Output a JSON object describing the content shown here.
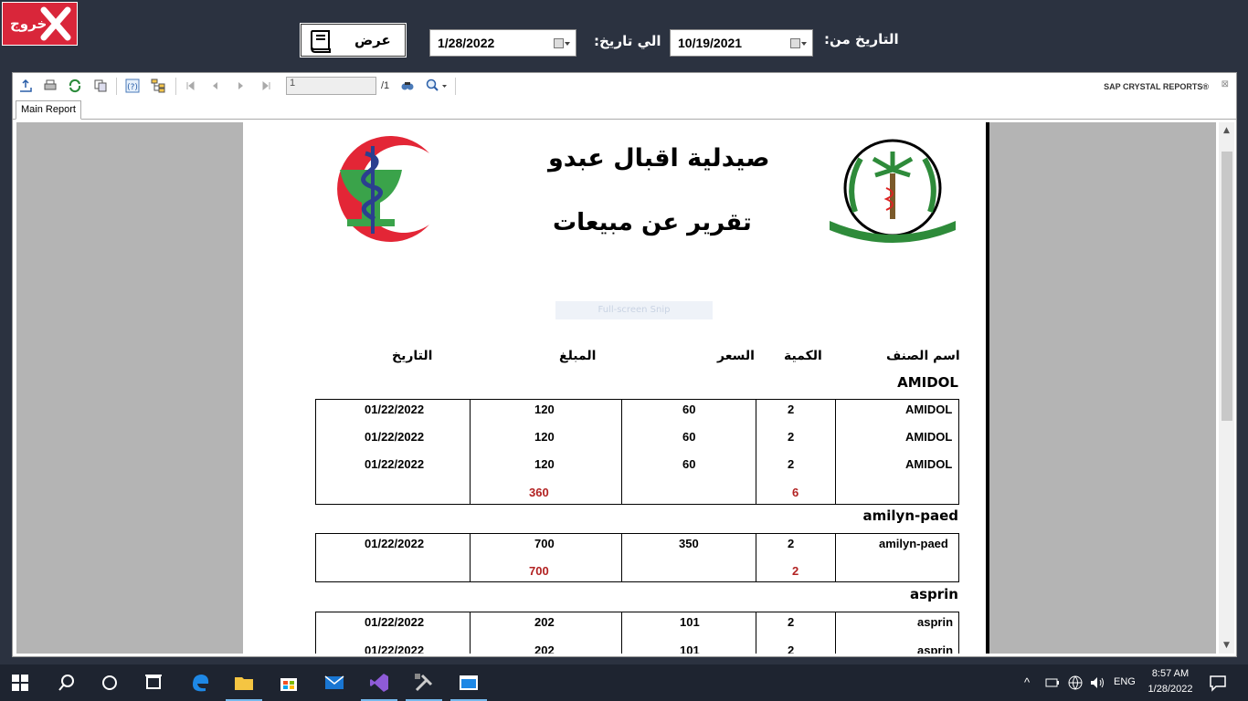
{
  "topbar": {
    "exit_label": "خروج",
    "show_label": "عرض",
    "to_label": "الي تاريخ:",
    "from_label": "التاريخ من:",
    "to_date": "1/28/2022",
    "from_date": "10/19/2021"
  },
  "viewer": {
    "page_value": "1",
    "page_total": "/1",
    "brand": "SAP CRYSTAL REPORTS®",
    "tab_label": "Main Report"
  },
  "report": {
    "title": "صيدلية اقبال عبدو",
    "subtitle": "تقرير عن مبيعات",
    "snip_text": "Full-screen Snip",
    "headers": {
      "item": "اسم الصنف",
      "qty": "الكمية",
      "price": "السعر",
      "amount": "المبلغ",
      "date": "التاريخ"
    },
    "groups": [
      {
        "name": "AMIDOL",
        "rows": [
          {
            "item": "AMIDOL",
            "qty": "2",
            "price": "60",
            "amount": "120",
            "date": "01/22/2022"
          },
          {
            "item": "AMIDOL",
            "qty": "2",
            "price": "60",
            "amount": "120",
            "date": "01/22/2022"
          },
          {
            "item": "AMIDOL",
            "qty": "2",
            "price": "60",
            "amount": "120",
            "date": "01/22/2022"
          }
        ],
        "total_qty": "6",
        "total_amount": "360"
      },
      {
        "name": "amilyn-paed",
        "rows": [
          {
            "item": "amilyn-paed",
            "qty": "2",
            "price": "350",
            "amount": "700",
            "date": "01/22/2022"
          }
        ],
        "total_qty": "2",
        "total_amount": "700"
      },
      {
        "name": "asprin",
        "rows": [
          {
            "item": "asprin",
            "qty": "2",
            "price": "101",
            "amount": "202",
            "date": "01/22/2022"
          },
          {
            "item": "asprin",
            "qty": "2",
            "price": "101",
            "amount": "202",
            "date": "01/22/2022"
          }
        ]
      }
    ]
  },
  "taskbar": {
    "lang": "ENG",
    "time": "8:57 AM",
    "date": "1/28/2022"
  },
  "colors": {
    "exit_red": "#d9263a",
    "total_red": "#b22222",
    "bg_dark": "#2b3240"
  },
  "icons": [
    "close-x-icon",
    "book-icon",
    "calendar-icon",
    "export-icon",
    "print-icon",
    "refresh-icon",
    "copy-icon",
    "help-icon",
    "group-tree-icon",
    "first-page-icon",
    "prev-page-icon",
    "next-page-icon",
    "last-page-icon",
    "find-icon",
    "zoom-icon",
    "windows-start-icon",
    "search-icon",
    "cortana-icon",
    "task-view-icon",
    "edge-icon",
    "file-explorer-icon",
    "store-icon",
    "mail-icon",
    "visual-studio-icon",
    "tools-icon",
    "app-icon",
    "network-icon",
    "volume-icon",
    "notification-icon"
  ]
}
